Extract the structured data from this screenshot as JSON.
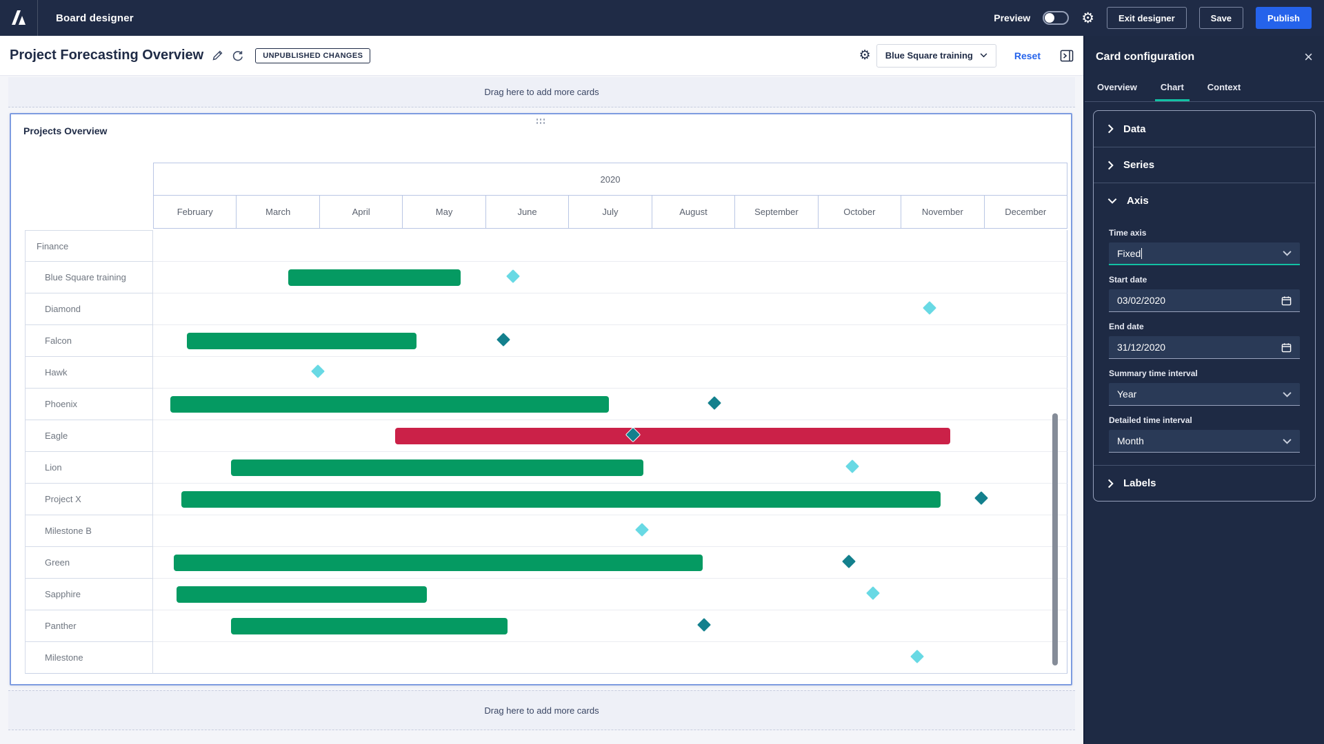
{
  "colors": {
    "topbar_navy": "#1F2B46",
    "panel_navy": "#1E2A44",
    "accent_teal": "#12C1A4",
    "publish_blue": "#2563EB",
    "bar_green": "#059A62",
    "bar_red": "#CB2148",
    "milestone_cyan": "#68D9E4",
    "milestone_teal": "#13808D",
    "selected_card_border": "#7D9BE0"
  },
  "topbar": {
    "app_title": "Board designer",
    "preview_label": "Preview",
    "preview_on": false,
    "exit_label": "Exit designer",
    "save_label": "Save",
    "publish_label": "Publish"
  },
  "header": {
    "title": "Project Forecasting Overview",
    "badge": "UNPUBLISHED CHANGES",
    "context_selector": "Blue Square training",
    "reset_label": "Reset"
  },
  "dropzones": {
    "top": "Drag here to add more cards",
    "bottom": "Drag here to add more cards"
  },
  "card": {
    "title": "Projects Overview"
  },
  "chart_data": {
    "type": "gantt",
    "title": "Projects Overview",
    "year_label": "2020",
    "months": [
      "February",
      "March",
      "April",
      "May",
      "June",
      "July",
      "August",
      "September",
      "October",
      "November",
      "December"
    ],
    "axis_note": "bar/milestone positions are in months since Feb 1 2020; axis spans Feb–Dec 2020 (11 months)",
    "axis_span_months": 11,
    "rows": [
      {
        "label": "Finance",
        "indent": 0
      },
      {
        "label": "Blue Square training",
        "indent": 1,
        "bar": {
          "start": 1.63,
          "end": 3.7,
          "color": "green"
        },
        "milestone": {
          "pos": 4.33,
          "color": "cyan"
        }
      },
      {
        "label": "Diamond",
        "indent": 1,
        "milestone": {
          "pos": 9.35,
          "color": "cyan"
        }
      },
      {
        "label": "Falcon",
        "indent": 1,
        "bar": {
          "start": 0.41,
          "end": 3.17,
          "color": "green"
        },
        "milestone": {
          "pos": 4.22,
          "color": "teal"
        }
      },
      {
        "label": "Hawk",
        "indent": 1,
        "milestone": {
          "pos": 1.98,
          "color": "cyan"
        }
      },
      {
        "label": "Phoenix",
        "indent": 1,
        "bar": {
          "start": 0.21,
          "end": 5.49,
          "color": "green"
        },
        "milestone": {
          "pos": 6.76,
          "color": "teal"
        }
      },
      {
        "label": "Eagle",
        "indent": 1,
        "bar": {
          "start": 2.91,
          "end": 9.6,
          "color": "red"
        },
        "milestone": {
          "pos": 5.78,
          "color": "teal"
        }
      },
      {
        "label": "Lion",
        "indent": 1,
        "bar": {
          "start": 0.94,
          "end": 5.9,
          "color": "green"
        },
        "milestone": {
          "pos": 8.42,
          "color": "cyan"
        }
      },
      {
        "label": "Project X",
        "indent": 1,
        "bar": {
          "start": 0.34,
          "end": 9.48,
          "color": "green"
        },
        "milestone": {
          "pos": 9.97,
          "color": "teal"
        }
      },
      {
        "label": "Milestone B",
        "indent": 1,
        "milestone": {
          "pos": 5.89,
          "color": "cyan"
        }
      },
      {
        "label": "Green",
        "indent": 1,
        "bar": {
          "start": 0.25,
          "end": 6.62,
          "color": "green"
        },
        "milestone": {
          "pos": 8.38,
          "color": "teal"
        }
      },
      {
        "label": "Sapphire",
        "indent": 1,
        "bar": {
          "start": 0.28,
          "end": 3.3,
          "color": "green"
        },
        "milestone": {
          "pos": 8.67,
          "color": "cyan"
        }
      },
      {
        "label": "Panther",
        "indent": 1,
        "bar": {
          "start": 0.94,
          "end": 4.27,
          "color": "green"
        },
        "milestone": {
          "pos": 6.63,
          "color": "teal"
        }
      },
      {
        "label": "Milestone",
        "indent": 1,
        "milestone": {
          "pos": 9.2,
          "color": "cyan"
        }
      }
    ]
  },
  "panel": {
    "title": "Card configuration",
    "tabs": [
      {
        "label": "Overview",
        "active": false
      },
      {
        "label": "Chart",
        "active": true
      },
      {
        "label": "Context",
        "active": false
      }
    ],
    "sections": {
      "data_label": "Data",
      "series_label": "Series",
      "axis_label": "Axis",
      "labels_label": "Labels"
    },
    "axis": {
      "time_axis_label": "Time axis",
      "time_axis_value": "Fixed",
      "start_date_label": "Start date",
      "start_date_value": "03/02/2020",
      "end_date_label": "End date",
      "end_date_value": "31/12/2020",
      "summary_label": "Summary time interval",
      "summary_value": "Year",
      "detailed_label": "Detailed time interval",
      "detailed_value": "Month"
    }
  }
}
